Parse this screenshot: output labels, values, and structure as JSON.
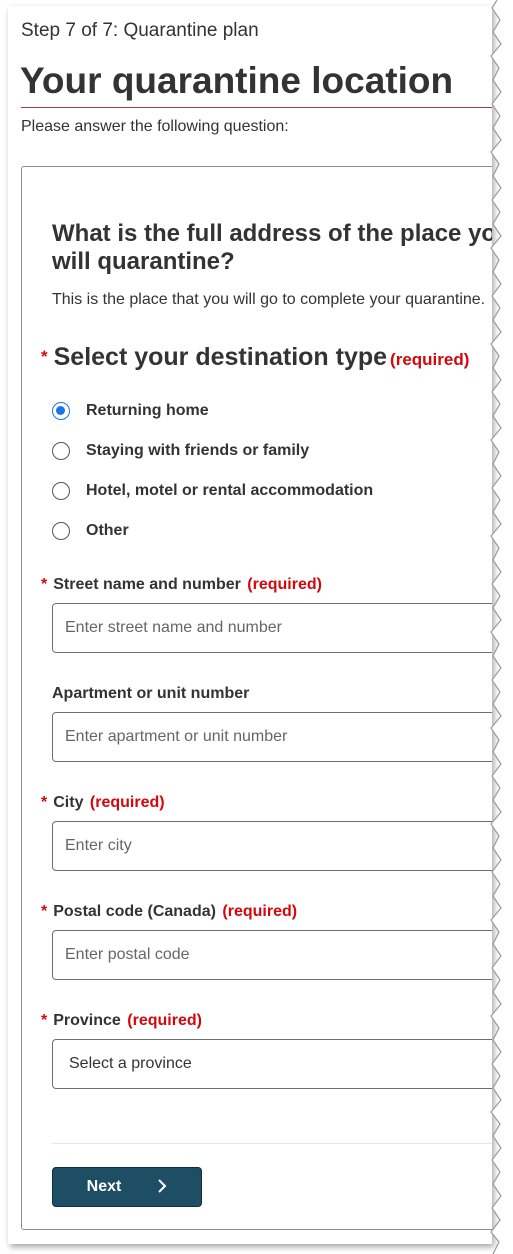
{
  "header": {
    "step": "Step 7 of 7: Quarantine plan",
    "title": "Your quarantine location",
    "intro": "Please answer the following question:"
  },
  "question": {
    "title": "What is the full address of the place you will quarantine?",
    "description": "This is the place that you will go to complete your quarantine."
  },
  "destination": {
    "legend": "Select your destination type",
    "required_marker": "*",
    "required_text": "(required)",
    "options": [
      {
        "label": "Returning home",
        "checked": true
      },
      {
        "label": "Staying with friends or family",
        "checked": false
      },
      {
        "label": "Hotel, motel or rental accommodation",
        "checked": false
      },
      {
        "label": "Other",
        "checked": false
      }
    ]
  },
  "fields": {
    "street": {
      "label": "Street name and number",
      "required": "(required)",
      "placeholder": "Enter street name and number"
    },
    "apartment": {
      "label": "Apartment or unit number",
      "placeholder": "Enter apartment or unit number"
    },
    "city": {
      "label": "City",
      "required": "(required)",
      "placeholder": "Enter city"
    },
    "postal": {
      "label": "Postal code (Canada)",
      "required": "(required)",
      "placeholder": "Enter postal code"
    },
    "province": {
      "label": "Province",
      "required": "(required)",
      "selected": "Select a province"
    }
  },
  "actions": {
    "next_label": "Next",
    "next_icon": "chevron-right-icon"
  },
  "colors": {
    "required": "#d3080c",
    "button": "#1d4e63",
    "radio_checked": "#1a73e8",
    "title_rule": "#af3c43"
  }
}
